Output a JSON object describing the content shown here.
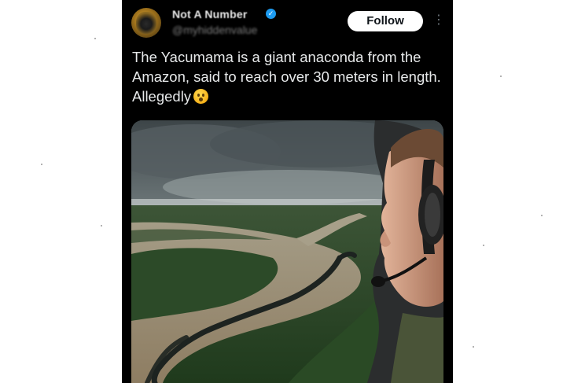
{
  "tweet": {
    "author": {
      "display_name": "Not A Number",
      "handle": "@myhiddenvalue",
      "verified": true,
      "avatar_icon": "lion-avatar-icon"
    },
    "follow_label": "Follow",
    "more_icon": "more-dots-icon",
    "text": "The Yacumama is a giant anaconda from the Amazon, said to reach over 30 meters in length. Allegedly",
    "text_emoji": "astonished-face-icon",
    "media_description_icon": "photo-image"
  },
  "colors": {
    "post_background": "#000000",
    "follow_button_bg": "#ffffff",
    "verified_badge": "#1d9bf0",
    "text_primary": "#e7e9ea"
  }
}
